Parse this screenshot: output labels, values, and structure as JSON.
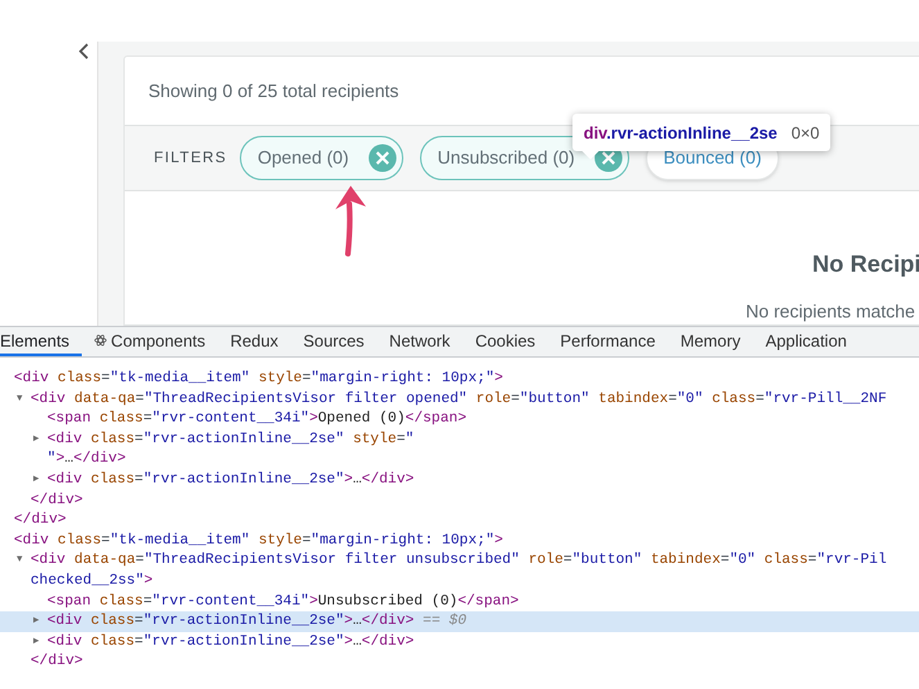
{
  "page": {
    "summary": "Showing 0 of 25 total recipients",
    "filters_label": "FILTERS",
    "pills": [
      {
        "label": "Opened (0)",
        "selected": true
      },
      {
        "label": "Unsubscribed (0)",
        "selected": true
      },
      {
        "label": "Bounced (0)",
        "selected": false
      }
    ],
    "empty_title": "No Recipi",
    "empty_text": "No recipients matche"
  },
  "tooltip": {
    "tag": "div",
    "selector": ".rvr-actionInline__2se",
    "size": "0×0"
  },
  "devtools": {
    "tabs": [
      {
        "label": "Elements",
        "selected": true,
        "kind": "plain"
      },
      {
        "label": "Components",
        "selected": false,
        "kind": "react"
      },
      {
        "label": "Redux",
        "selected": false,
        "kind": "plain"
      },
      {
        "label": "Sources",
        "selected": false,
        "kind": "plain"
      },
      {
        "label": "Network",
        "selected": false,
        "kind": "plain"
      },
      {
        "label": "Cookies",
        "selected": false,
        "kind": "plain"
      },
      {
        "label": "Performance",
        "selected": false,
        "kind": "plain"
      },
      {
        "label": "Memory",
        "selected": false,
        "kind": "plain"
      },
      {
        "label": "Application",
        "selected": false,
        "kind": "plain"
      }
    ],
    "dom": [
      {
        "highlighted": false,
        "segments": [
          {
            "kind": "tag",
            "text": "<div"
          },
          {
            "kind": "attr",
            "text": " class"
          },
          {
            "kind": "eq",
            "text": "="
          },
          {
            "kind": "value",
            "text": "\"tk-media__item\""
          },
          {
            "kind": "attr",
            "text": " style"
          },
          {
            "kind": "eq",
            "text": "="
          },
          {
            "kind": "value",
            "text": "\"margin-right: 10px;\""
          },
          {
            "kind": "tag",
            "text": ">"
          }
        ],
        "children": [
          {
            "toggle": "▼",
            "highlighted": false,
            "segments": [
              {
                "kind": "tag",
                "text": "<div"
              },
              {
                "kind": "attr",
                "text": " data-qa"
              },
              {
                "kind": "eq",
                "text": "="
              },
              {
                "kind": "value",
                "text": "\"ThreadRecipientsVisor filter opened\""
              },
              {
                "kind": "attr",
                "text": " role"
              },
              {
                "kind": "eq",
                "text": "="
              },
              {
                "kind": "value",
                "text": "\"button\""
              },
              {
                "kind": "attr",
                "text": " tabindex"
              },
              {
                "kind": "eq",
                "text": "="
              },
              {
                "kind": "value",
                "text": "\"0\""
              },
              {
                "kind": "attr",
                "text": " class"
              },
              {
                "kind": "eq",
                "text": "="
              },
              {
                "kind": "value",
                "text": "\"rvr-Pill__2NF"
              }
            ],
            "children": [
              {
                "highlighted": false,
                "segments": [
                  {
                    "kind": "tag",
                    "text": "<span"
                  },
                  {
                    "kind": "attr",
                    "text": " class"
                  },
                  {
                    "kind": "eq",
                    "text": "="
                  },
                  {
                    "kind": "value",
                    "text": "\"rvr-content__34i\""
                  },
                  {
                    "kind": "tag",
                    "text": ">"
                  },
                  {
                    "kind": "text",
                    "text": "Opened (0)"
                  },
                  {
                    "kind": "tag",
                    "text": "</span>"
                  }
                ]
              },
              {
                "toggle": "▶",
                "highlighted": false,
                "segments": [
                  {
                    "kind": "tag",
                    "text": "<div"
                  },
                  {
                    "kind": "attr",
                    "text": " class"
                  },
                  {
                    "kind": "eq",
                    "text": "="
                  },
                  {
                    "kind": "value",
                    "text": "\"rvr-actionInline__2se\""
                  },
                  {
                    "kind": "attr",
                    "text": " style"
                  },
                  {
                    "kind": "eq",
                    "text": "="
                  },
                  {
                    "kind": "value",
                    "text": "\""
                  },
                  {
                    "kind": "break"
                  },
                  {
                    "kind": "value",
                    "text": "\""
                  },
                  {
                    "kind": "tag",
                    "text": ">"
                  },
                  {
                    "kind": "text",
                    "text": "…"
                  },
                  {
                    "kind": "tag",
                    "text": "</div>"
                  }
                ]
              },
              {
                "toggle": "▶",
                "highlighted": false,
                "segments": [
                  {
                    "kind": "tag",
                    "text": "<div"
                  },
                  {
                    "kind": "attr",
                    "text": " class"
                  },
                  {
                    "kind": "eq",
                    "text": "="
                  },
                  {
                    "kind": "value",
                    "text": "\"rvr-actionInline__2se\""
                  },
                  {
                    "kind": "tag",
                    "text": ">"
                  },
                  {
                    "kind": "text",
                    "text": "…"
                  },
                  {
                    "kind": "tag",
                    "text": "</div>"
                  }
                ]
              }
            ],
            "close": "</div>"
          }
        ],
        "close": "</div>"
      },
      {
        "highlighted": false,
        "segments": [
          {
            "kind": "tag",
            "text": "<div"
          },
          {
            "kind": "attr",
            "text": " class"
          },
          {
            "kind": "eq",
            "text": "="
          },
          {
            "kind": "value",
            "text": "\"tk-media__item\""
          },
          {
            "kind": "attr",
            "text": " style"
          },
          {
            "kind": "eq",
            "text": "="
          },
          {
            "kind": "value",
            "text": "\"margin-right: 10px;\""
          },
          {
            "kind": "tag",
            "text": ">"
          }
        ],
        "children": [
          {
            "toggle": "▼",
            "highlighted": false,
            "segments": [
              {
                "kind": "tag",
                "text": "<div"
              },
              {
                "kind": "attr",
                "text": " data-qa"
              },
              {
                "kind": "eq",
                "text": "="
              },
              {
                "kind": "value",
                "text": "\"ThreadRecipientsVisor filter unsubscribed\""
              },
              {
                "kind": "attr",
                "text": " role"
              },
              {
                "kind": "eq",
                "text": "="
              },
              {
                "kind": "value",
                "text": "\"button\""
              },
              {
                "kind": "attr",
                "text": " tabindex"
              },
              {
                "kind": "eq",
                "text": "="
              },
              {
                "kind": "value",
                "text": "\"0\""
              },
              {
                "kind": "attr",
                "text": " class"
              },
              {
                "kind": "eq",
                "text": "="
              },
              {
                "kind": "value",
                "text": "\"rvr-Pil"
              },
              {
                "kind": "break"
              },
              {
                "kind": "value",
                "text": "checked__2ss\""
              },
              {
                "kind": "tag",
                "text": ">"
              }
            ],
            "children": [
              {
                "highlighted": false,
                "segments": [
                  {
                    "kind": "tag",
                    "text": "<span"
                  },
                  {
                    "kind": "attr",
                    "text": " class"
                  },
                  {
                    "kind": "eq",
                    "text": "="
                  },
                  {
                    "kind": "value",
                    "text": "\"rvr-content__34i\""
                  },
                  {
                    "kind": "tag",
                    "text": ">"
                  },
                  {
                    "kind": "text",
                    "text": "Unsubscribed (0)"
                  },
                  {
                    "kind": "tag",
                    "text": "</span>"
                  }
                ]
              },
              {
                "toggle": "▶",
                "highlighted": true,
                "segments": [
                  {
                    "kind": "tag",
                    "text": "<div"
                  },
                  {
                    "kind": "attr",
                    "text": " class"
                  },
                  {
                    "kind": "eq",
                    "text": "="
                  },
                  {
                    "kind": "value",
                    "text": "\"rvr-actionInline__2se\""
                  },
                  {
                    "kind": "tag",
                    "text": ">"
                  },
                  {
                    "kind": "text",
                    "text": "…"
                  },
                  {
                    "kind": "tag",
                    "text": "</div>"
                  },
                  {
                    "kind": "ref",
                    "text": " == $0"
                  }
                ]
              },
              {
                "toggle": "▶",
                "highlighted": false,
                "segments": [
                  {
                    "kind": "tag",
                    "text": "<div"
                  },
                  {
                    "kind": "attr",
                    "text": " class"
                  },
                  {
                    "kind": "eq",
                    "text": "="
                  },
                  {
                    "kind": "value",
                    "text": "\"rvr-actionInline__2se\""
                  },
                  {
                    "kind": "tag",
                    "text": ">"
                  },
                  {
                    "kind": "text",
                    "text": "…"
                  },
                  {
                    "kind": "tag",
                    "text": "</div>"
                  }
                ]
              }
            ],
            "close": "</div>"
          }
        ]
      }
    ]
  }
}
